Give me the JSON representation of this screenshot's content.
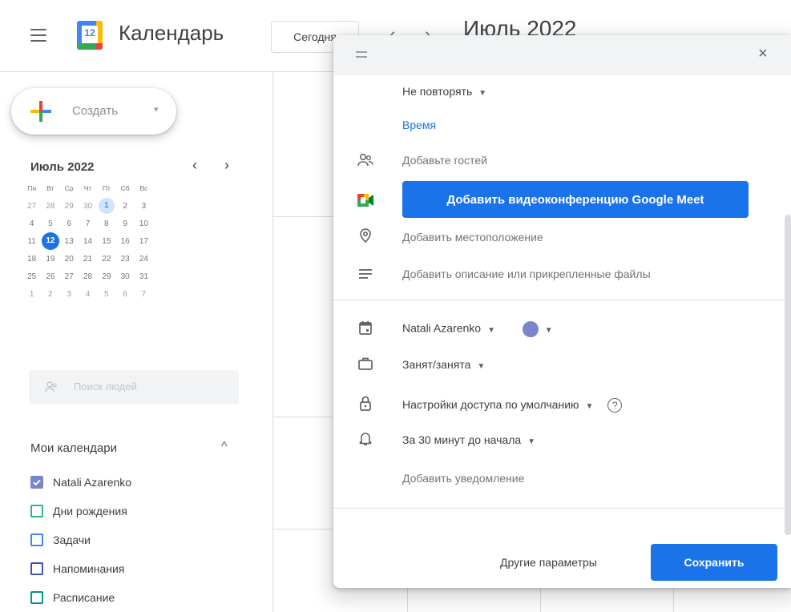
{
  "header": {
    "app_title": "Календарь",
    "logo_day": "12",
    "today_label": "Сегодня",
    "prev_label": "‹",
    "next_label": "›",
    "month_title": "Июль 2022"
  },
  "sidebar": {
    "create_label": "Создать",
    "create_caret": "▾",
    "mini_calendar": {
      "month_label": "Июль 2022",
      "weekdays": [
        "Пн",
        "Вт",
        "Ср",
        "Чт",
        "Пт",
        "Сб",
        "Вс"
      ],
      "weeks": [
        [
          "27",
          "28",
          "29",
          "30",
          "1",
          "2",
          "3"
        ],
        [
          "4",
          "5",
          "6",
          "7",
          "8",
          "9",
          "10"
        ],
        [
          "11",
          "12",
          "13",
          "14",
          "15",
          "16",
          "17"
        ],
        [
          "18",
          "19",
          "20",
          "21",
          "22",
          "23",
          "24"
        ],
        [
          "25",
          "26",
          "27",
          "28",
          "29",
          "30",
          "31"
        ],
        [
          "1",
          "2",
          "3",
          "4",
          "5",
          "6",
          "7"
        ]
      ],
      "today": "12",
      "selected": "1"
    },
    "people_search_placeholder": "Поиск людей",
    "my_calendars_title": "Мои календари",
    "my_calendars": [
      {
        "label": "Natali Azarenko",
        "color": "#7986cb",
        "checked": true
      },
      {
        "label": "Дни рождения",
        "color": "#33b679",
        "checked": false
      },
      {
        "label": "Задачи",
        "color": "#4285f4",
        "checked": false
      },
      {
        "label": "Напоминания",
        "color": "#3f51b5",
        "checked": false
      },
      {
        "label": "Расписание",
        "color": "#009688",
        "checked": false
      }
    ]
  },
  "dialog": {
    "close_label": "×",
    "repeat_label": "Не повторять",
    "time_link": "Время",
    "guests_label": "Добавьте гостей",
    "meet_button": "Добавить видеоконференцию Google Meet",
    "location_label": "Добавить местоположение",
    "description_label": "Добавить описание или прикрепленные файлы",
    "calendar_owner": "Natali Azarenko",
    "event_color": "#7986cb",
    "busy_label": "Занят/занята",
    "visibility_label": "Настройки доступа по умолчанию",
    "help_label": "?",
    "reminder_label": "За 30 минут до начала",
    "add_reminder_label": "Добавить уведомление",
    "more_options_label": "Другие параметры",
    "save_label": "Сохранить"
  }
}
